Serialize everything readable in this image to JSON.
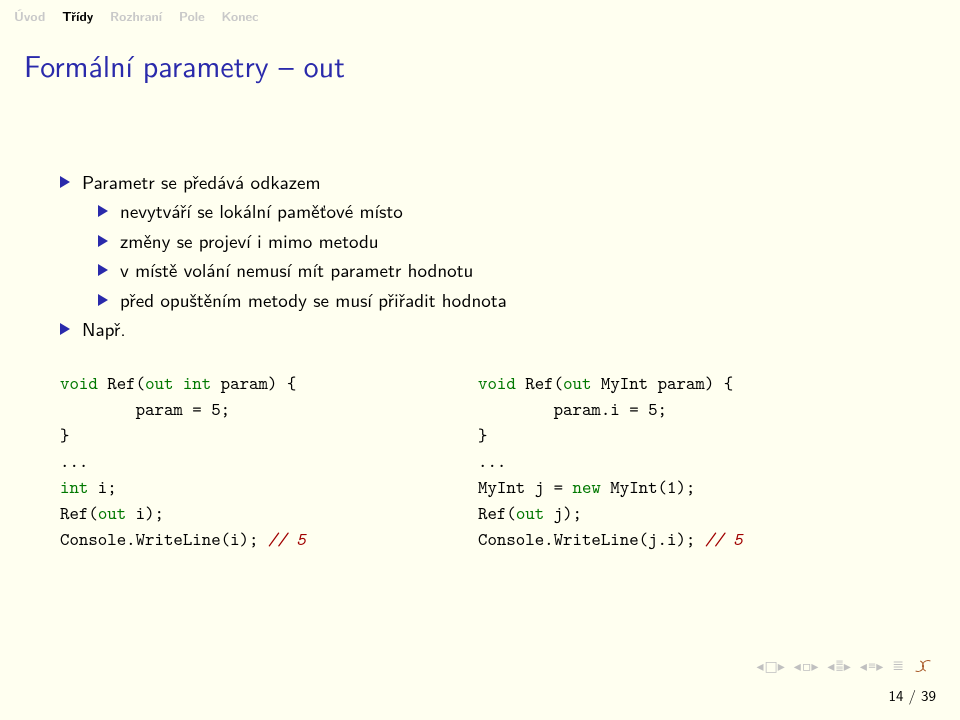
{
  "nav": {
    "items": [
      "Úvod",
      "Třídy",
      "Rozhraní",
      "Pole",
      "Konec"
    ],
    "active_index": 1
  },
  "title": "Formální parametry – out",
  "bullets": {
    "l1a": "Parametr se předává odkazem",
    "l2a": "nevytváří se lokální paměťové místo",
    "l2b": "změny se projeví i mimo metodu",
    "l2c": "v místě volání nemusí mít parametr hodnotu",
    "l2d": "před opuštěním metody se musí přiřadit hodnota",
    "l1b": "Např."
  },
  "code": {
    "left": {
      "l1a": "void",
      "l1b": " Ref(",
      "l1c": "out int",
      "l1d": " param) {",
      "l2": "        param = 5;",
      "l3": "}",
      "l4": "...",
      "l5a": "int",
      "l5b": " i;",
      "l6a": "Ref(",
      "l6b": "out",
      "l6c": " i);",
      "l7a": "Console.WriteLine(i); ",
      "l7b": "// 5"
    },
    "right": {
      "l1a": "void",
      "l1b": " Ref(",
      "l1c": "out",
      "l1d": " MyInt param) {",
      "l2": "        param.i = 5;",
      "l3": "}",
      "l4": "...",
      "l5a": "MyInt j = ",
      "l5b": "new",
      "l5c": " MyInt(1);",
      "l6a": "Ref(",
      "l6b": "out",
      "l6c": " j);",
      "l7a": "Console.WriteLine(j.i); ",
      "l7b": "// 5"
    }
  },
  "page": {
    "current": "14",
    "sep": " / ",
    "total": "39"
  }
}
